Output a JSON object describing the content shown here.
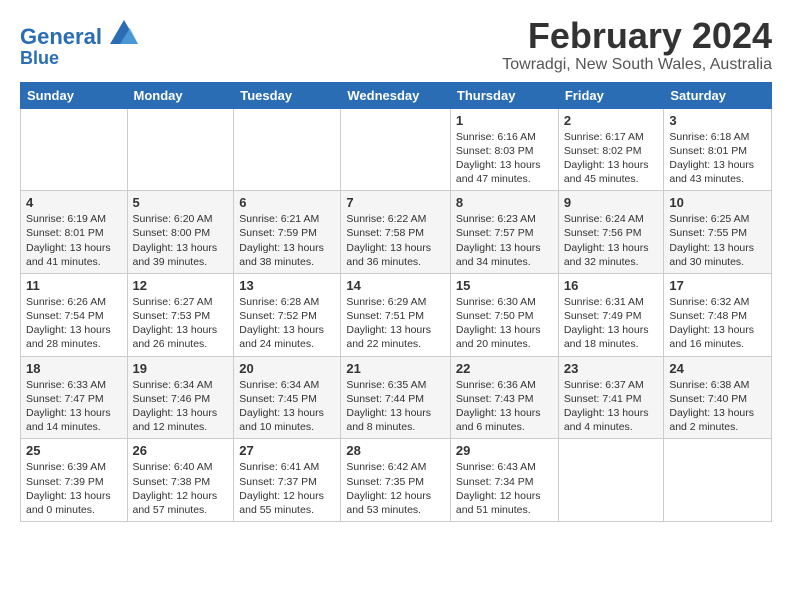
{
  "logo": {
    "line1": "General",
    "line2": "Blue"
  },
  "title": "February 2024",
  "subtitle": "Towradgi, New South Wales, Australia",
  "days_of_week": [
    "Sunday",
    "Monday",
    "Tuesday",
    "Wednesday",
    "Thursday",
    "Friday",
    "Saturday"
  ],
  "weeks": [
    [
      {
        "day": "",
        "detail": ""
      },
      {
        "day": "",
        "detail": ""
      },
      {
        "day": "",
        "detail": ""
      },
      {
        "day": "",
        "detail": ""
      },
      {
        "day": "1",
        "detail": "Sunrise: 6:16 AM\nSunset: 8:03 PM\nDaylight: 13 hours\nand 47 minutes."
      },
      {
        "day": "2",
        "detail": "Sunrise: 6:17 AM\nSunset: 8:02 PM\nDaylight: 13 hours\nand 45 minutes."
      },
      {
        "day": "3",
        "detail": "Sunrise: 6:18 AM\nSunset: 8:01 PM\nDaylight: 13 hours\nand 43 minutes."
      }
    ],
    [
      {
        "day": "4",
        "detail": "Sunrise: 6:19 AM\nSunset: 8:01 PM\nDaylight: 13 hours\nand 41 minutes."
      },
      {
        "day": "5",
        "detail": "Sunrise: 6:20 AM\nSunset: 8:00 PM\nDaylight: 13 hours\nand 39 minutes."
      },
      {
        "day": "6",
        "detail": "Sunrise: 6:21 AM\nSunset: 7:59 PM\nDaylight: 13 hours\nand 38 minutes."
      },
      {
        "day": "7",
        "detail": "Sunrise: 6:22 AM\nSunset: 7:58 PM\nDaylight: 13 hours\nand 36 minutes."
      },
      {
        "day": "8",
        "detail": "Sunrise: 6:23 AM\nSunset: 7:57 PM\nDaylight: 13 hours\nand 34 minutes."
      },
      {
        "day": "9",
        "detail": "Sunrise: 6:24 AM\nSunset: 7:56 PM\nDaylight: 13 hours\nand 32 minutes."
      },
      {
        "day": "10",
        "detail": "Sunrise: 6:25 AM\nSunset: 7:55 PM\nDaylight: 13 hours\nand 30 minutes."
      }
    ],
    [
      {
        "day": "11",
        "detail": "Sunrise: 6:26 AM\nSunset: 7:54 PM\nDaylight: 13 hours\nand 28 minutes."
      },
      {
        "day": "12",
        "detail": "Sunrise: 6:27 AM\nSunset: 7:53 PM\nDaylight: 13 hours\nand 26 minutes."
      },
      {
        "day": "13",
        "detail": "Sunrise: 6:28 AM\nSunset: 7:52 PM\nDaylight: 13 hours\nand 24 minutes."
      },
      {
        "day": "14",
        "detail": "Sunrise: 6:29 AM\nSunset: 7:51 PM\nDaylight: 13 hours\nand 22 minutes."
      },
      {
        "day": "15",
        "detail": "Sunrise: 6:30 AM\nSunset: 7:50 PM\nDaylight: 13 hours\nand 20 minutes."
      },
      {
        "day": "16",
        "detail": "Sunrise: 6:31 AM\nSunset: 7:49 PM\nDaylight: 13 hours\nand 18 minutes."
      },
      {
        "day": "17",
        "detail": "Sunrise: 6:32 AM\nSunset: 7:48 PM\nDaylight: 13 hours\nand 16 minutes."
      }
    ],
    [
      {
        "day": "18",
        "detail": "Sunrise: 6:33 AM\nSunset: 7:47 PM\nDaylight: 13 hours\nand 14 minutes."
      },
      {
        "day": "19",
        "detail": "Sunrise: 6:34 AM\nSunset: 7:46 PM\nDaylight: 13 hours\nand 12 minutes."
      },
      {
        "day": "20",
        "detail": "Sunrise: 6:34 AM\nSunset: 7:45 PM\nDaylight: 13 hours\nand 10 minutes."
      },
      {
        "day": "21",
        "detail": "Sunrise: 6:35 AM\nSunset: 7:44 PM\nDaylight: 13 hours\nand 8 minutes."
      },
      {
        "day": "22",
        "detail": "Sunrise: 6:36 AM\nSunset: 7:43 PM\nDaylight: 13 hours\nand 6 minutes."
      },
      {
        "day": "23",
        "detail": "Sunrise: 6:37 AM\nSunset: 7:41 PM\nDaylight: 13 hours\nand 4 minutes."
      },
      {
        "day": "24",
        "detail": "Sunrise: 6:38 AM\nSunset: 7:40 PM\nDaylight: 13 hours\nand 2 minutes."
      }
    ],
    [
      {
        "day": "25",
        "detail": "Sunrise: 6:39 AM\nSunset: 7:39 PM\nDaylight: 13 hours\nand 0 minutes."
      },
      {
        "day": "26",
        "detail": "Sunrise: 6:40 AM\nSunset: 7:38 PM\nDaylight: 12 hours\nand 57 minutes."
      },
      {
        "day": "27",
        "detail": "Sunrise: 6:41 AM\nSunset: 7:37 PM\nDaylight: 12 hours\nand 55 minutes."
      },
      {
        "day": "28",
        "detail": "Sunrise: 6:42 AM\nSunset: 7:35 PM\nDaylight: 12 hours\nand 53 minutes."
      },
      {
        "day": "29",
        "detail": "Sunrise: 6:43 AM\nSunset: 7:34 PM\nDaylight: 12 hours\nand 51 minutes."
      },
      {
        "day": "",
        "detail": ""
      },
      {
        "day": "",
        "detail": ""
      }
    ]
  ]
}
